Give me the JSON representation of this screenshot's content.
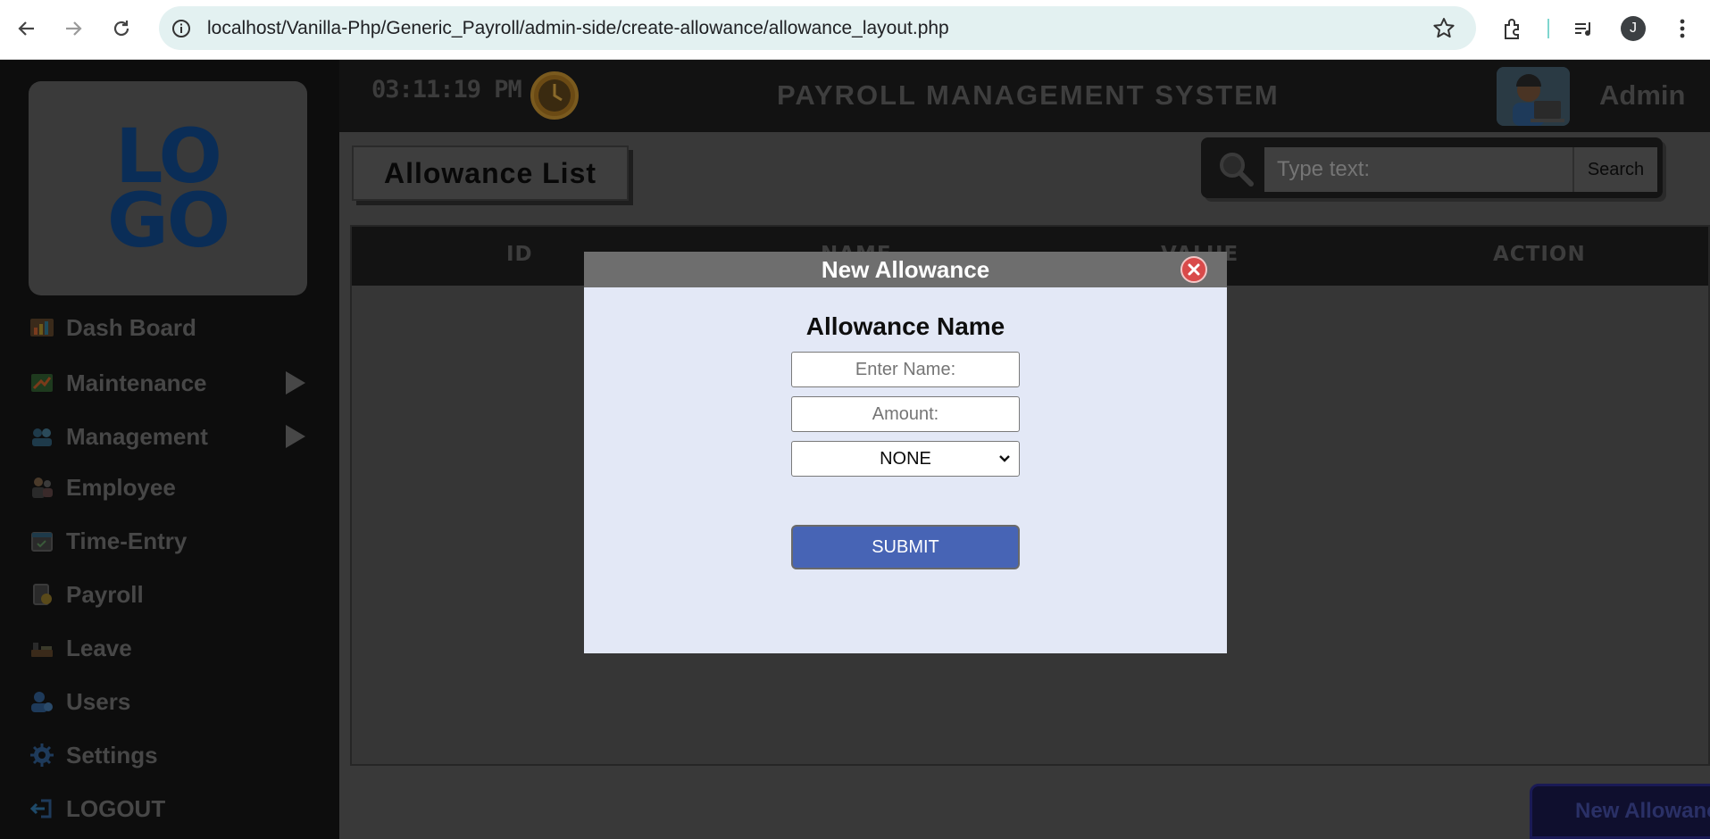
{
  "browser": {
    "url": "localhost/Vanilla-Php/Generic_Payroll/admin-side/create-allowance/allowance_layout.php",
    "profile_initial": "J",
    "icons": [
      "back-icon",
      "forward-icon",
      "reload-icon",
      "site-info-icon",
      "bookmark-star-icon",
      "extensions-icon",
      "media-control-icon",
      "profile-avatar",
      "more-menu-icon"
    ]
  },
  "sidebar": {
    "logo_line1": "LO",
    "logo_line2": "GO",
    "items": [
      {
        "label": "Dash Board",
        "icon": "dashboard-icon"
      },
      {
        "label": "Maintenance",
        "icon": "maintenance-icon",
        "has_submenu": true
      },
      {
        "label": "Management",
        "icon": "management-icon",
        "has_submenu": true
      },
      {
        "label": "Employee",
        "icon": "employee-icon"
      },
      {
        "label": "Time-Entry",
        "icon": "calendar-icon"
      },
      {
        "label": "Payroll",
        "icon": "payroll-icon"
      },
      {
        "label": "Leave",
        "icon": "leave-icon"
      },
      {
        "label": "Users",
        "icon": "users-icon"
      },
      {
        "label": "Settings",
        "icon": "gear-icon"
      },
      {
        "label": "LOGOUT",
        "icon": "logout-icon"
      }
    ]
  },
  "header": {
    "clock": "03:11:19 PM",
    "title": "PAYROLL MANAGEMENT SYSTEM",
    "user": "Admin"
  },
  "main": {
    "page_title": "Allowance List",
    "search": {
      "placeholder": "Type text:",
      "button_label": "Search"
    },
    "table": {
      "columns": [
        "ID",
        "NAME",
        "VALUE",
        "ACTION"
      ]
    },
    "new_button_label": "New Allowance"
  },
  "modal": {
    "title": "New Allowance",
    "subtitle": "Allowance Name",
    "name_placeholder": "Enter Name:",
    "amount_placeholder": "Amount:",
    "select_value": "NONE",
    "submit_label": "SUBMIT"
  },
  "colors": {
    "modal_bg": "#e3e8f6",
    "submit_blue": "#4764b5",
    "close_red": "#d94a4a",
    "logo_navy": "#0a2d57"
  }
}
